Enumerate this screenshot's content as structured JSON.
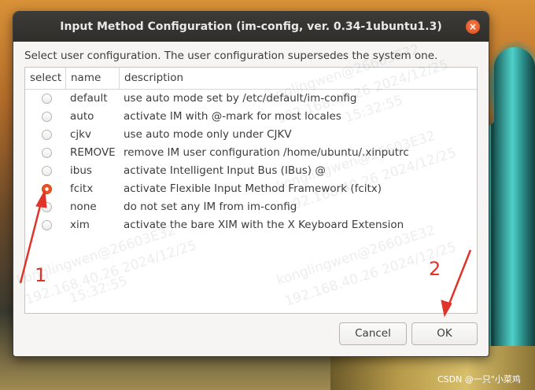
{
  "window": {
    "title": "Input Method Configuration (im-config, ver. 0.34-1ubuntu1.3)",
    "close_glyph": "×"
  },
  "prompt": "Select user configuration. The user configuration supersedes the system one.",
  "table": {
    "headers": [
      "select",
      "name",
      "description"
    ],
    "rows": [
      {
        "name": "default",
        "description": "use auto mode set by /etc/default/im-config",
        "selected": false
      },
      {
        "name": "auto",
        "description": "activate IM with @-mark for most locales",
        "selected": false
      },
      {
        "name": "cjkv",
        "description": "use auto mode only under CJKV",
        "selected": false
      },
      {
        "name": "REMOVE",
        "description": "remove IM user configuration /home/ubuntu/.xinputrc",
        "selected": false
      },
      {
        "name": "ibus",
        "description": "activate Intelligent Input Bus (IBus) @",
        "selected": false
      },
      {
        "name": "fcitx",
        "description": "activate Flexible Input Method Framework (fcitx)",
        "selected": true
      },
      {
        "name": "none",
        "description": "do not set any IM from im-config",
        "selected": false
      },
      {
        "name": "xim",
        "description": "activate the bare XIM with the X Keyboard Extension",
        "selected": false
      }
    ]
  },
  "buttons": {
    "cancel": "Cancel",
    "ok": "OK"
  },
  "annotations": {
    "step1": "1",
    "step2": "2",
    "color": "#e0332a"
  },
  "watermark": {
    "line1": "konglingwen@26603E32",
    "line2": "192.168.40.26 2024/12/25",
    "line3": "15:32:55",
    "footer": "CSDN @一只\"小菜鸡"
  },
  "colors": {
    "accent": "#e95420",
    "titlebar": "#3c3b37",
    "dialog_bg": "#f6f5f4"
  }
}
